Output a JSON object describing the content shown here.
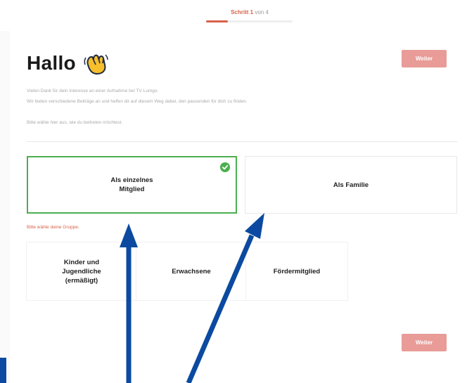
{
  "steps": {
    "step_prefix": "Schritt 1",
    "step_suffix": " von 4",
    "progress": 0.25
  },
  "header": {
    "title": "Hallo",
    "next_label": "Weiter"
  },
  "intro": {
    "line1": "Vielen Dank für dein Interesse an einer Aufnahme bei TV Lumgo.",
    "line2": "Wir bieten verschiedene Beiträge an und helfen dir auf diesem Weg dabei, den passenden für dich zu finden.",
    "line3": "Bitte wähle hier aus, wie du beitreten möchtest."
  },
  "membership": {
    "options": [
      {
        "label": "Als einzelnes\nMitglied",
        "selected": true
      },
      {
        "label": "Als Familie",
        "selected": false
      }
    ]
  },
  "group": {
    "hint": "Bitte wähle deine Gruppe.",
    "options": [
      {
        "label": "Kinder und\nJugendliche\n(ermäßigt)"
      },
      {
        "label": "Erwachsene"
      },
      {
        "label": "Fördermitglied"
      }
    ]
  },
  "footer": {
    "next_label": "Weiter"
  },
  "colors": {
    "accent": "#d8624a",
    "button": "#e89b97",
    "selected": "#4caf50",
    "arrow": "#0b4aa0"
  },
  "icons": {
    "greeting": "waving-hand-icon",
    "selected_mark": "check-icon"
  }
}
